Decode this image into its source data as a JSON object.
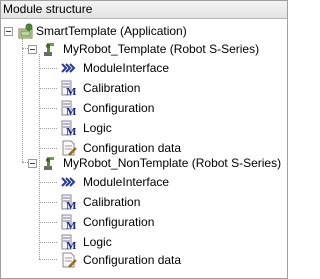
{
  "panel": {
    "title": "Module structure"
  },
  "tree": {
    "root": {
      "label": "SmartTemplate (Application)",
      "icon": "application-icon",
      "expanded": true
    },
    "robots": [
      {
        "label": "MyRobot_Template (Robot S-Series)",
        "icon": "robot-icon",
        "expanded": true,
        "children": [
          {
            "label": "ModuleInterface",
            "icon": "module-interface-icon"
          },
          {
            "label": "Calibration",
            "icon": "calibration-module-icon"
          },
          {
            "label": "Configuration",
            "icon": "configuration-module-icon"
          },
          {
            "label": "Logic",
            "icon": "logic-module-icon"
          },
          {
            "label": "Configuration data",
            "icon": "configuration-data-icon"
          }
        ]
      },
      {
        "label": "MyRobot_NonTemplate (Robot S-Series)",
        "icon": "robot-icon",
        "expanded": true,
        "children": [
          {
            "label": "ModuleInterface",
            "icon": "module-interface-icon"
          },
          {
            "label": "Calibration",
            "icon": "calibration-module-icon"
          },
          {
            "label": "Configuration",
            "icon": "configuration-module-icon"
          },
          {
            "label": "Logic",
            "icon": "logic-module-icon"
          },
          {
            "label": "Configuration data",
            "icon": "configuration-data-icon"
          }
        ]
      }
    ]
  }
}
